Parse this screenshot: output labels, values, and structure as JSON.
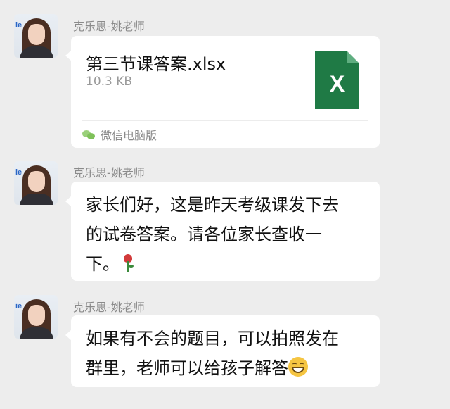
{
  "messages": [
    {
      "sender": "克乐思-姚老师",
      "type": "file",
      "file_name": "第三节课答案.xlsx",
      "file_size": "10.3 KB",
      "file_icon_letter": "X",
      "file_icon_color": "#1f7a45",
      "source_label": "微信电脑版"
    },
    {
      "sender": "克乐思-姚老师",
      "type": "text",
      "lines": [
        "家长们好，这是昨天考级课发下去",
        "的试卷答案。请各位家长查收一",
        "下。"
      ],
      "emoji": "rose-icon"
    },
    {
      "sender": "克乐思-姚老师",
      "type": "text",
      "lines": [
        "如果有不会的题目，可以拍照发在",
        "群里，老师可以给孩子解答"
      ],
      "emoji": "grinning-face-icon"
    }
  ],
  "colors": {
    "background": "#ededed",
    "bubble": "#ffffff",
    "sender_name": "#8a8a8a"
  }
}
